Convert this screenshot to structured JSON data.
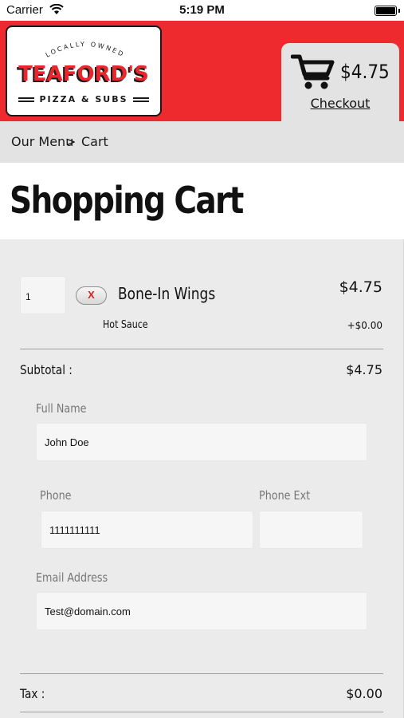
{
  "status_bar": {
    "carrier": "Carrier",
    "time": "5:19 PM"
  },
  "header": {
    "logo": {
      "tagline": "LOCALLY OWNED",
      "name": "TEAFORD'S",
      "subtitle": "PIZZA & SUBS"
    },
    "cart_total": "$4.75",
    "checkout_label": "Checkout",
    "colors": {
      "brand_red": "#ee2a2e",
      "tab_gray": "#e3e3e3"
    }
  },
  "breadcrumb": {
    "items": [
      "Our Menu",
      "Cart"
    ],
    "separator": ">"
  },
  "page_title": "Shopping Cart",
  "cart": {
    "items": [
      {
        "quantity": "1",
        "remove_label": "X",
        "name": "Bone-In Wings",
        "price": "$4.75",
        "options": [
          {
            "name": "Hot Sauce",
            "price": "+$0.00"
          }
        ]
      }
    ],
    "subtotal_label": "Subtotal :",
    "subtotal_value": "$4.75",
    "tax_label": "Tax :",
    "tax_value": "$0.00"
  },
  "form": {
    "full_name": {
      "label": "Full Name",
      "value": "John Doe"
    },
    "phone": {
      "label": "Phone",
      "value": "1111111111"
    },
    "phone_ext": {
      "label": "Phone Ext",
      "value": ""
    },
    "email": {
      "label": "Email Address",
      "value": "Test@domain.com"
    }
  }
}
